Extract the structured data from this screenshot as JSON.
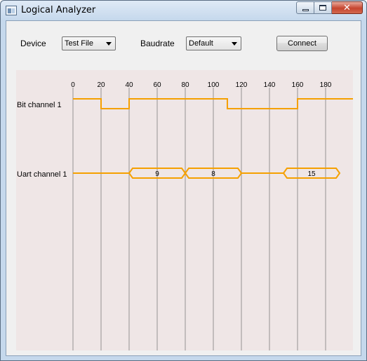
{
  "window": {
    "title": "Logical Analyzer",
    "icon": "app-window-icon",
    "controls": {
      "minimize_icon": "minimize-icon",
      "maximize_icon": "maximize-icon",
      "close_glyph": "✕"
    }
  },
  "toolbar": {
    "device_label": "Device",
    "device_value": "Test File",
    "baudrate_label": "Baudrate",
    "baudrate_value": "Default",
    "connect_label": "Connect"
  },
  "colors": {
    "signal": "#f5a000",
    "gridline": "#a9a6a6",
    "canvas_bg": "#efe6e6"
  },
  "timeline": {
    "ticks": [
      "0",
      "20",
      "40",
      "60",
      "80",
      "100",
      "120",
      "140",
      "160",
      "180"
    ],
    "tick_values": [
      0,
      20,
      40,
      60,
      80,
      100,
      120,
      140,
      160,
      180
    ],
    "range": [
      0,
      200
    ]
  },
  "channels": [
    {
      "name": "Bit channel 1",
      "type": "bit",
      "levels": [
        {
          "from": 0,
          "to": 20,
          "level": 1
        },
        {
          "from": 20,
          "to": 40,
          "level": 0
        },
        {
          "from": 40,
          "to": 110,
          "level": 1
        },
        {
          "from": 110,
          "to": 160,
          "level": 0
        },
        {
          "from": 160,
          "to": 200,
          "level": 1
        }
      ]
    },
    {
      "name": "Uart channel 1",
      "type": "uart",
      "frames": [
        {
          "from": 40,
          "to": 80,
          "value": "9"
        },
        {
          "from": 80,
          "to": 120,
          "value": "8"
        },
        {
          "from": 150,
          "to": 190,
          "value": "15"
        }
      ]
    }
  ]
}
